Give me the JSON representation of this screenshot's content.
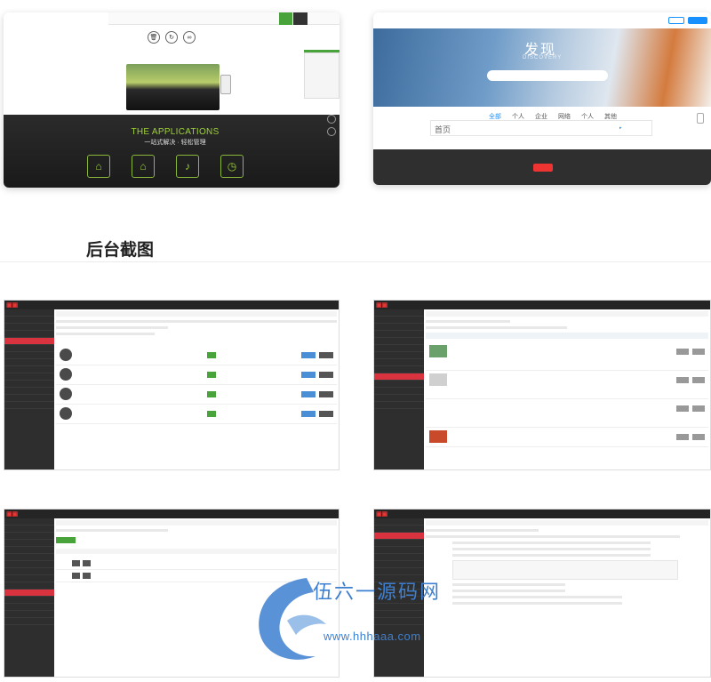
{
  "preview_left": {
    "apps_title": "THE APPLICATIONS",
    "apps_subtitle": "一站式解决 · 轻松管理",
    "app_icons": [
      "bag-icon",
      "home-icon",
      "speaker-icon",
      "clock-icon"
    ]
  },
  "preview_right": {
    "hero_title": "发现",
    "hero_subtitle": "DISCOVERY",
    "tabs": [
      "全部",
      "个人",
      "企业",
      "网络",
      "个人",
      "其他"
    ],
    "search_label": "首页"
  },
  "section": {
    "heading": "后台截图"
  },
  "watermark": {
    "title": "伍六一源码网",
    "url": "www.hhhaaa.com"
  },
  "colors": {
    "brand_red": "#d9333f",
    "brand_green": "#48a43a",
    "watermark_blue": "#3d7fd0"
  }
}
